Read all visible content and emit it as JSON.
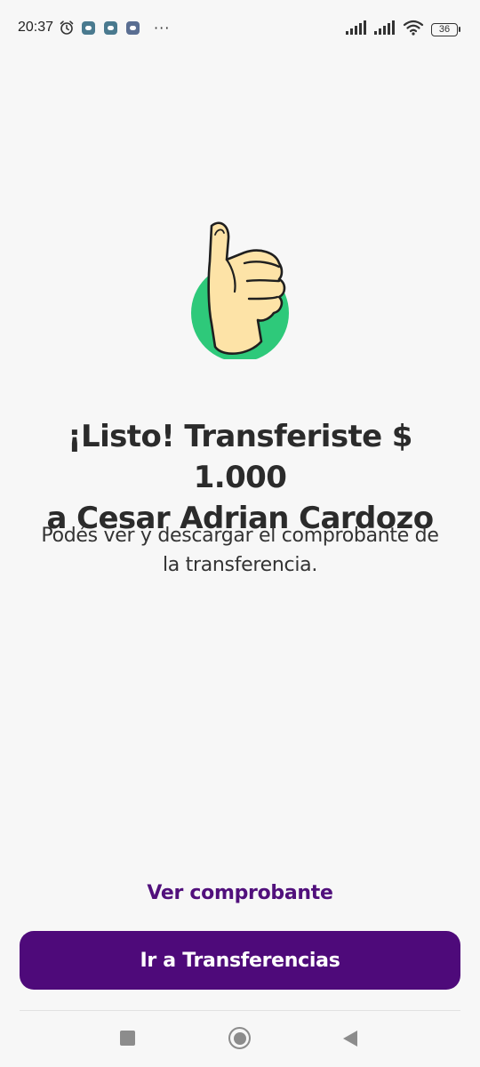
{
  "status_bar": {
    "time": "20:37",
    "icons": [
      "alarm-icon",
      "message-badge-icon",
      "message-badge-icon",
      "app-badge-icon",
      "more-dots-icon",
      "signal-icon",
      "signal-icon",
      "wifi-icon",
      "battery-icon"
    ],
    "more": "···",
    "battery_level": "36"
  },
  "success": {
    "illustration": "thumbs-up-icon",
    "title_line1": "¡Listo! Transferiste $ 1.000",
    "title_line2": "a Cesar Adrian Cardozo",
    "subtitle_line1": "Podés ver y descargar el comprobante de",
    "subtitle_line2": "la transferencia."
  },
  "actions": {
    "view_receipt_label": "Ver comprobante",
    "go_transfers_label": "Ir a Transferencias"
  },
  "colors": {
    "primary": "#4e0a7a",
    "link": "#51107c",
    "accent_green": "#2ec97a",
    "hand": "#fde3a7",
    "background": "#f7f7f7"
  },
  "nav_bar": {
    "icons": [
      "recents-icon",
      "home-icon",
      "back-icon"
    ]
  }
}
